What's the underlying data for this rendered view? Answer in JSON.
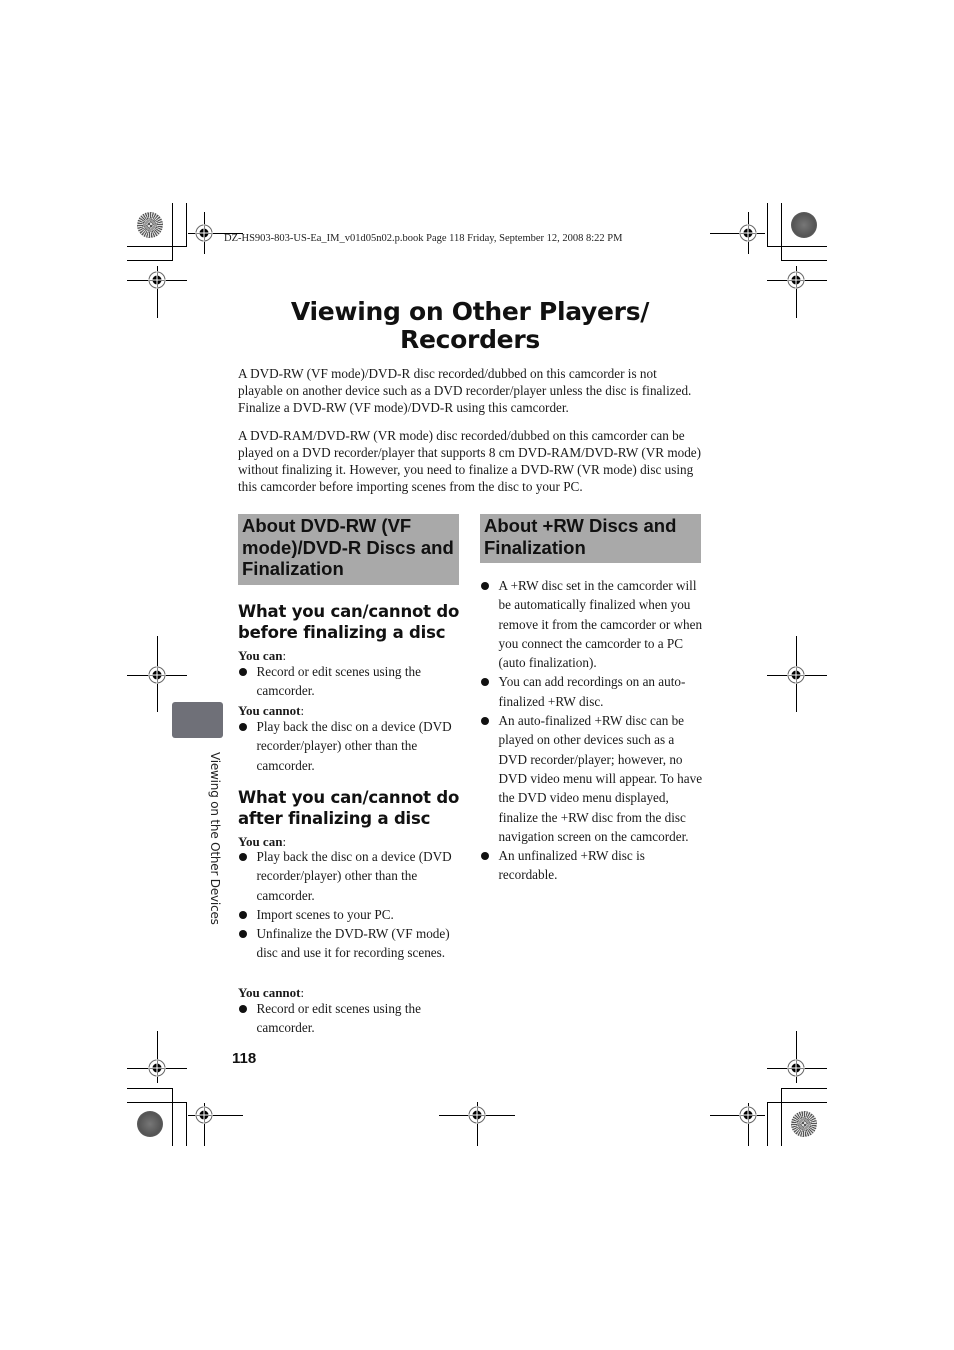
{
  "print_slug": "DZ-HS903-803-US-Ea_IM_v01d05n02.p.book  Page 118  Friday, September 12, 2008  8:22 PM",
  "page_title_line1": "Viewing on Other Players/",
  "page_title_line2": "Recorders",
  "intro": {
    "paragraph1": "A DVD-RW (VF mode)/DVD-R disc recorded/dubbed on this camcorder is not playable on another device such as a DVD recorder/player unless the disc is finalized. Finalize a DVD-RW (VF mode)/DVD-R using this camcorder.",
    "paragraph2": "A DVD-RAM/DVD-RW (VR mode) disc recorded/dubbed on this camcorder can be played on a DVD recorder/player that supports 8 cm DVD-RAM/DVD-RW (VR mode) without finalizing it. However, you need to finalize a DVD-RW (VR mode) disc using this camcorder before importing scenes from the disc to your PC."
  },
  "left_section": {
    "heading": "About DVD-RW (VF mode)/DVD-R Discs and Finalization",
    "before": {
      "heading": "What you can/cannot do before finalizing a disc",
      "can_label": "You can",
      "can_items": [
        "Record or edit scenes using the camcorder."
      ],
      "cannot_label": "You cannot",
      "cannot_items": [
        "Play back the disc on a device (DVD recorder/player) other than the camcorder."
      ]
    },
    "after": {
      "heading": "What you can/cannot do after finalizing a disc",
      "can_label": "You can",
      "can_items": [
        "Play back the disc on a device (DVD recorder/player) other than the camcorder.",
        "Import scenes to your PC.",
        "Unfinalize the DVD-RW (VF mode) disc and use it for recording scenes."
      ],
      "cannot_label": "You cannot",
      "cannot_items": [
        "Record or edit scenes using the camcorder."
      ]
    }
  },
  "right_section": {
    "heading": "About +RW Discs and Finalization",
    "items": [
      "A +RW disc set in the camcorder will be automatically finalized when you remove it from the camcorder or when you connect the camcorder to a PC (auto finalization).",
      "You can add recordings on an auto-finalized +RW disc.",
      "An auto-finalized +RW disc can be played on other devices such as a DVD recorder/player; however, no DVD video menu will appear. To have the DVD video menu displayed, finalize the +RW disc from the disc navigation screen on the camcorder.",
      "An unfinalized +RW disc is recordable."
    ]
  },
  "side_tab_text": "Viewing on the Other Devices",
  "page_number": "118",
  "colors": {
    "section_heading_bg": "#a9a9a9",
    "side_tab": "#6f7078"
  }
}
